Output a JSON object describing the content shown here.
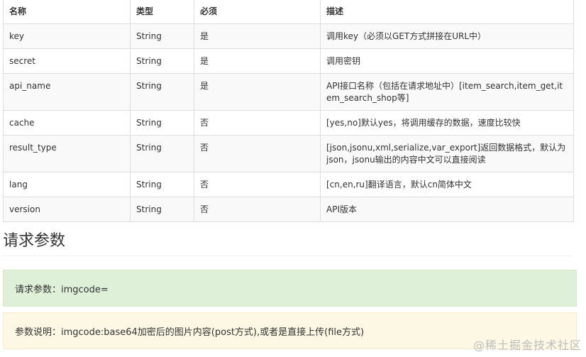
{
  "table": {
    "headers": [
      "名称",
      "类型",
      "必须",
      "描述"
    ],
    "rows": [
      {
        "name": "key",
        "type": "String",
        "required": "是",
        "desc": "调用key（必须以GET方式拼接在URL中）"
      },
      {
        "name": "secret",
        "type": "String",
        "required": "是",
        "desc": "调用密钥"
      },
      {
        "name": "api_name",
        "type": "String",
        "required": "是",
        "desc": "API接口名称（包括在请求地址中）[item_search,item_get,item_search_shop等]"
      },
      {
        "name": "cache",
        "type": "String",
        "required": "否",
        "desc": "[yes,no]默认yes，将调用缓存的数据，速度比较快"
      },
      {
        "name": "result_type",
        "type": "String",
        "required": "否",
        "desc": "[json,jsonu,xml,serialize,var_export]返回数据格式，默认为json，jsonu输出的内容中文可以直接阅读"
      },
      {
        "name": "lang",
        "type": "String",
        "required": "否",
        "desc": "[cn,en,ru]翻译语言，默认cn简体中文"
      },
      {
        "name": "version",
        "type": "String",
        "required": "否",
        "desc": "API版本"
      }
    ]
  },
  "section": {
    "title": "请求参数"
  },
  "alerts": {
    "request_params": "请求参数：imgcode=",
    "param_desc": "参数说明：imgcode:base64加密后的图片内容(post方式),或者是直接上传(file方式)"
  },
  "watermark": {
    "text": "@稀土掘金技术社区"
  }
}
